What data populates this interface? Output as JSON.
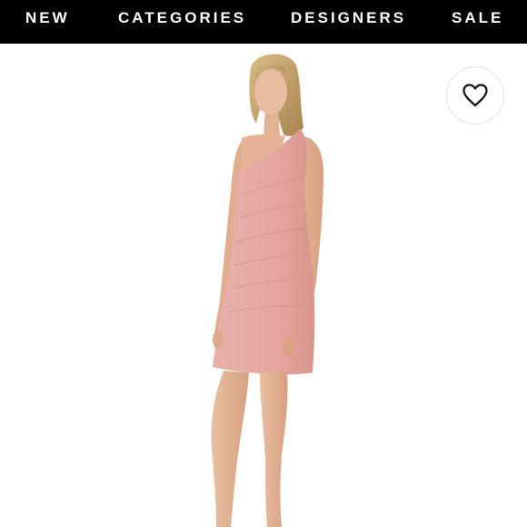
{
  "nav": {
    "items": [
      {
        "label": "NEW"
      },
      {
        "label": "CATEGORIES"
      },
      {
        "label": "DESIGNERS"
      },
      {
        "label": "SALE"
      }
    ]
  },
  "product": {
    "favorite_icon": "heart-outline-icon",
    "dress_color": "#E7AAA4",
    "skin_color": "#E3B394",
    "hair_color": "#C8A56E"
  },
  "colors": {
    "nav_background": "#000000",
    "nav_text": "#FFFFFF",
    "page_background": "#FFFFFF"
  }
}
